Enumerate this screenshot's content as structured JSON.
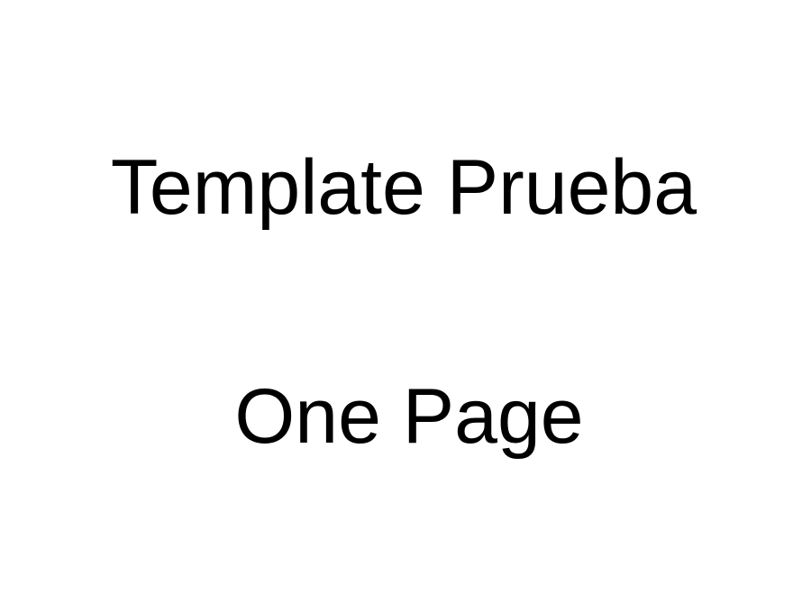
{
  "content": {
    "title": "Template Prueba",
    "subtitle": "One Page"
  }
}
